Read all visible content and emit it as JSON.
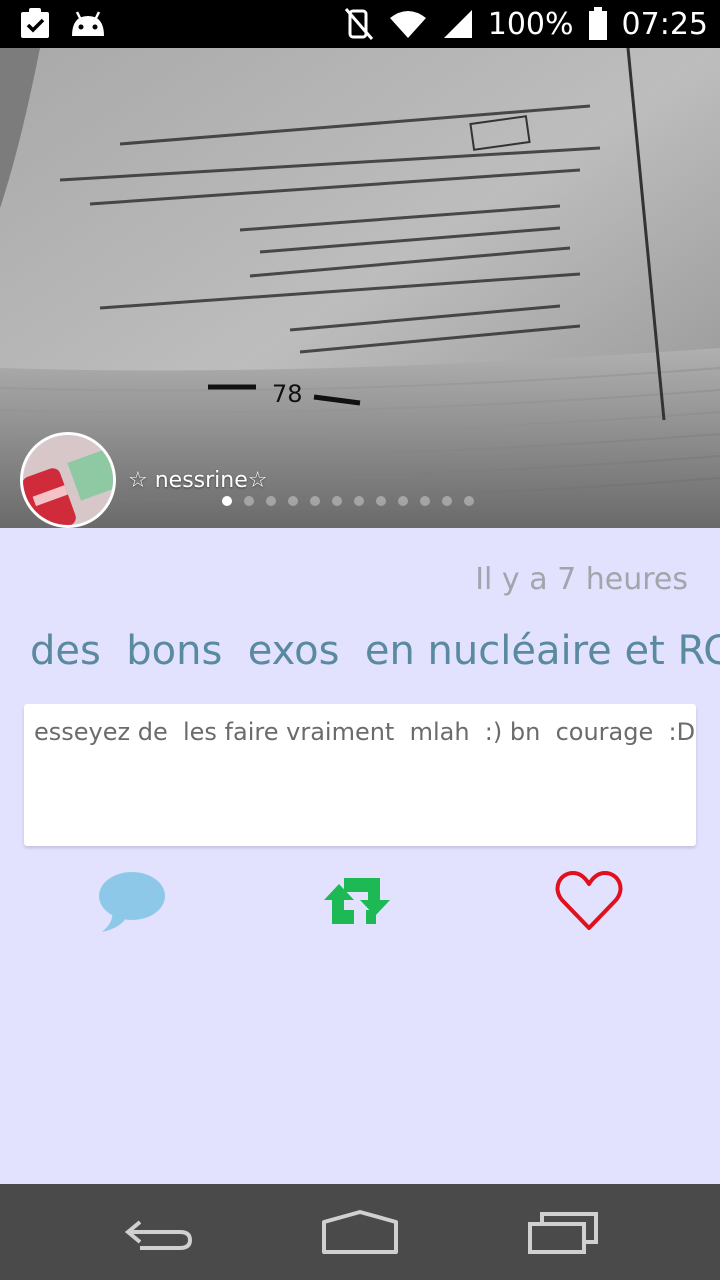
{
  "status_bar": {
    "battery_percent": "100%",
    "time": "07:25",
    "icons": [
      "clipboard-check-icon",
      "android-icon",
      "mute-icon",
      "wifi-icon",
      "signal-icon",
      "battery-icon"
    ]
  },
  "hero": {
    "username": "☆ nessrine☆",
    "page_number": "78",
    "carousel_total": 12,
    "carousel_active": 0
  },
  "post": {
    "timestamp": "Il y a 7 heures",
    "title": "des  bons  exos  en nucléaire et RC",
    "body": "esseyez de  les faire vraiment  mlah  :) bn  courage  :D"
  },
  "actions": {
    "comment_icon": "speech-bubble-icon",
    "repost_icon": "repost-icon",
    "like_icon": "heart-icon"
  },
  "colors": {
    "background": "#e2e2ff",
    "title": "#5a8aa0",
    "comment": "#8ec8e8",
    "repost": "#1db954",
    "like": "#e0101c",
    "navbar": "#4a4a4a"
  }
}
